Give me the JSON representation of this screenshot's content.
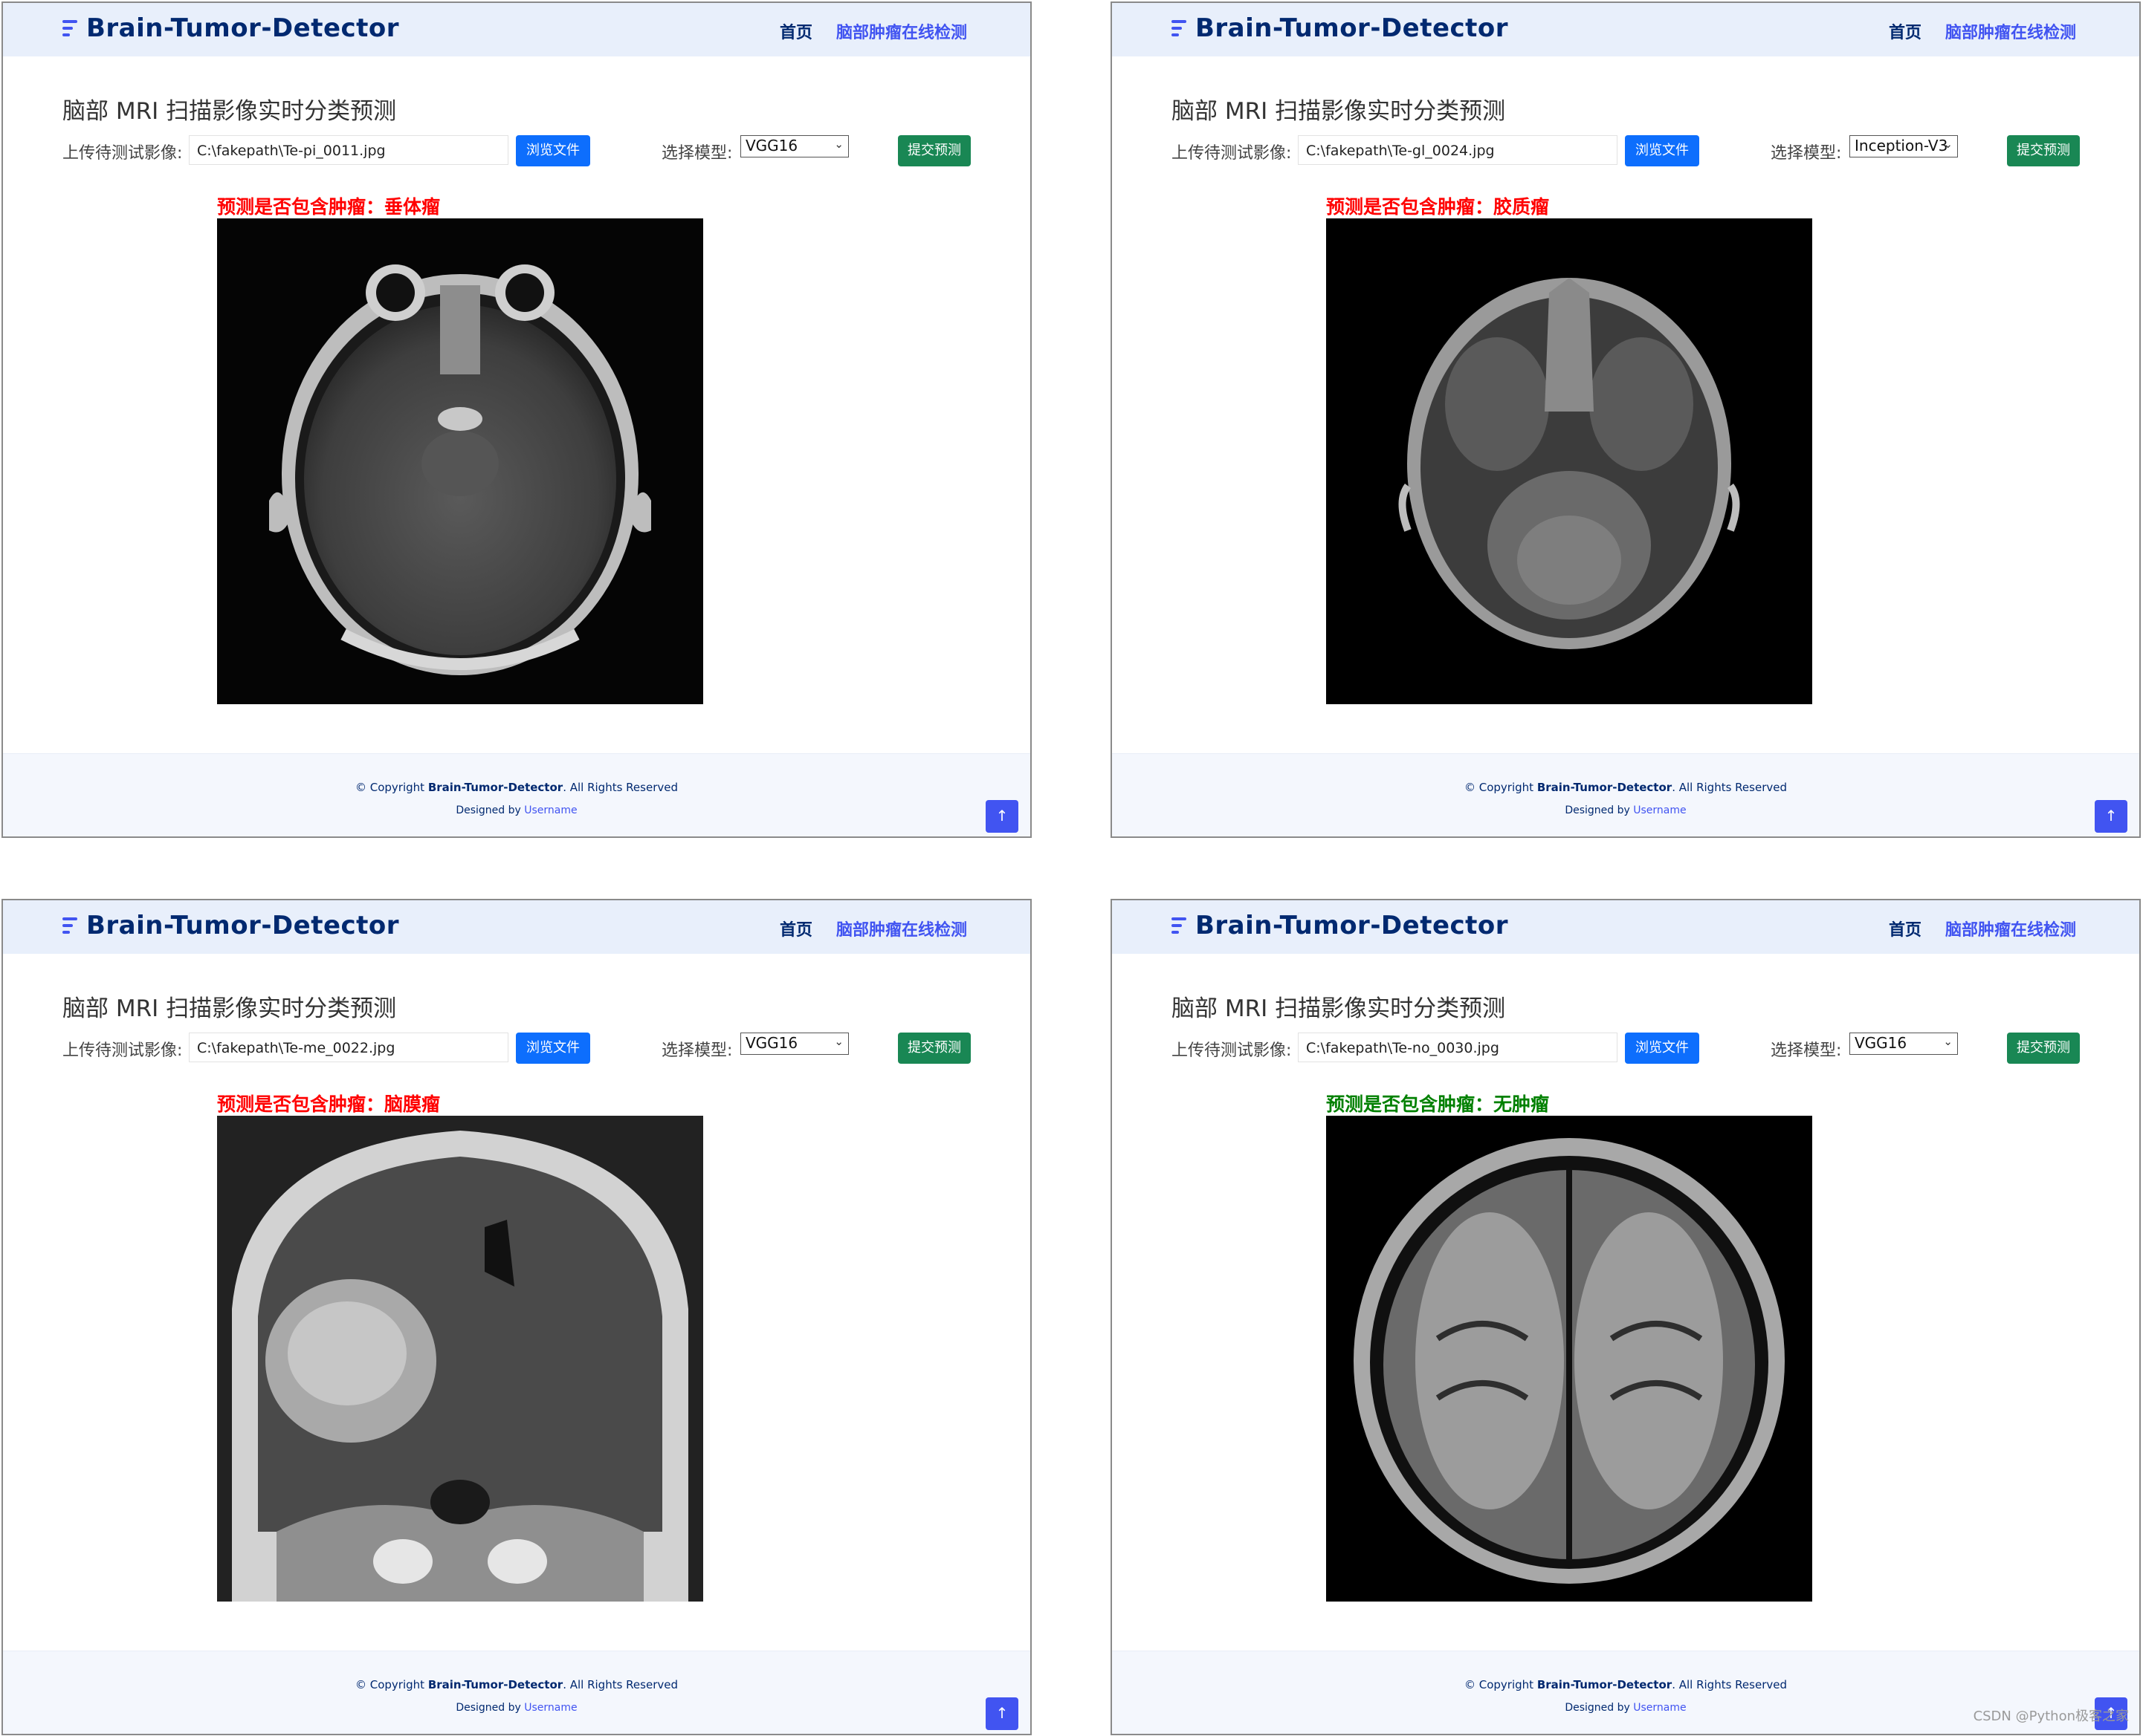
{
  "app": {
    "brand": "Brain-Tumor-Detector",
    "nav": {
      "home": "首页",
      "detect": "脑部肿瘤在线检测"
    },
    "page_title": "脑部 MRI 扫描影像实时分类预测",
    "upload_label": "上传待测试影像:",
    "browse_label": "浏览文件",
    "model_label": "选择模型:",
    "submit_label": "提交预测",
    "copyright_prefix": "© Copyright",
    "copyright_brand": "Brain-Tumor-Detector",
    "copyright_suffix": ". All Rights Reserved",
    "designed_by": "Designed by",
    "designer": "Username",
    "back_to_top_icon": "arrow-up-icon"
  },
  "panels": [
    {
      "file_path": "C:\\fakepath\\Te-pi_0011.jpg",
      "model": "VGG16",
      "prediction_prefix": "预测是否包含肿瘤：",
      "prediction_result": "垂体瘤",
      "prediction_color": "#ff0000"
    },
    {
      "file_path": "C:\\fakepath\\Te-gl_0024.jpg",
      "model": "Inception-V3",
      "prediction_prefix": "预测是否包含肿瘤：",
      "prediction_result": "胶质瘤",
      "prediction_color": "#ff0000"
    },
    {
      "file_path": "C:\\fakepath\\Te-me_0022.jpg",
      "model": "VGG16",
      "prediction_prefix": "预测是否包含肿瘤：",
      "prediction_result": "脑膜瘤",
      "prediction_color": "#ff0000"
    },
    {
      "file_path": "C:\\fakepath\\Te-no_0030.jpg",
      "model": "VGG16",
      "prediction_prefix": "预测是否包含肿瘤：",
      "prediction_result": "无肿瘤",
      "prediction_color": "#008000"
    }
  ],
  "watermark": "CSDN @Python极客之家"
}
